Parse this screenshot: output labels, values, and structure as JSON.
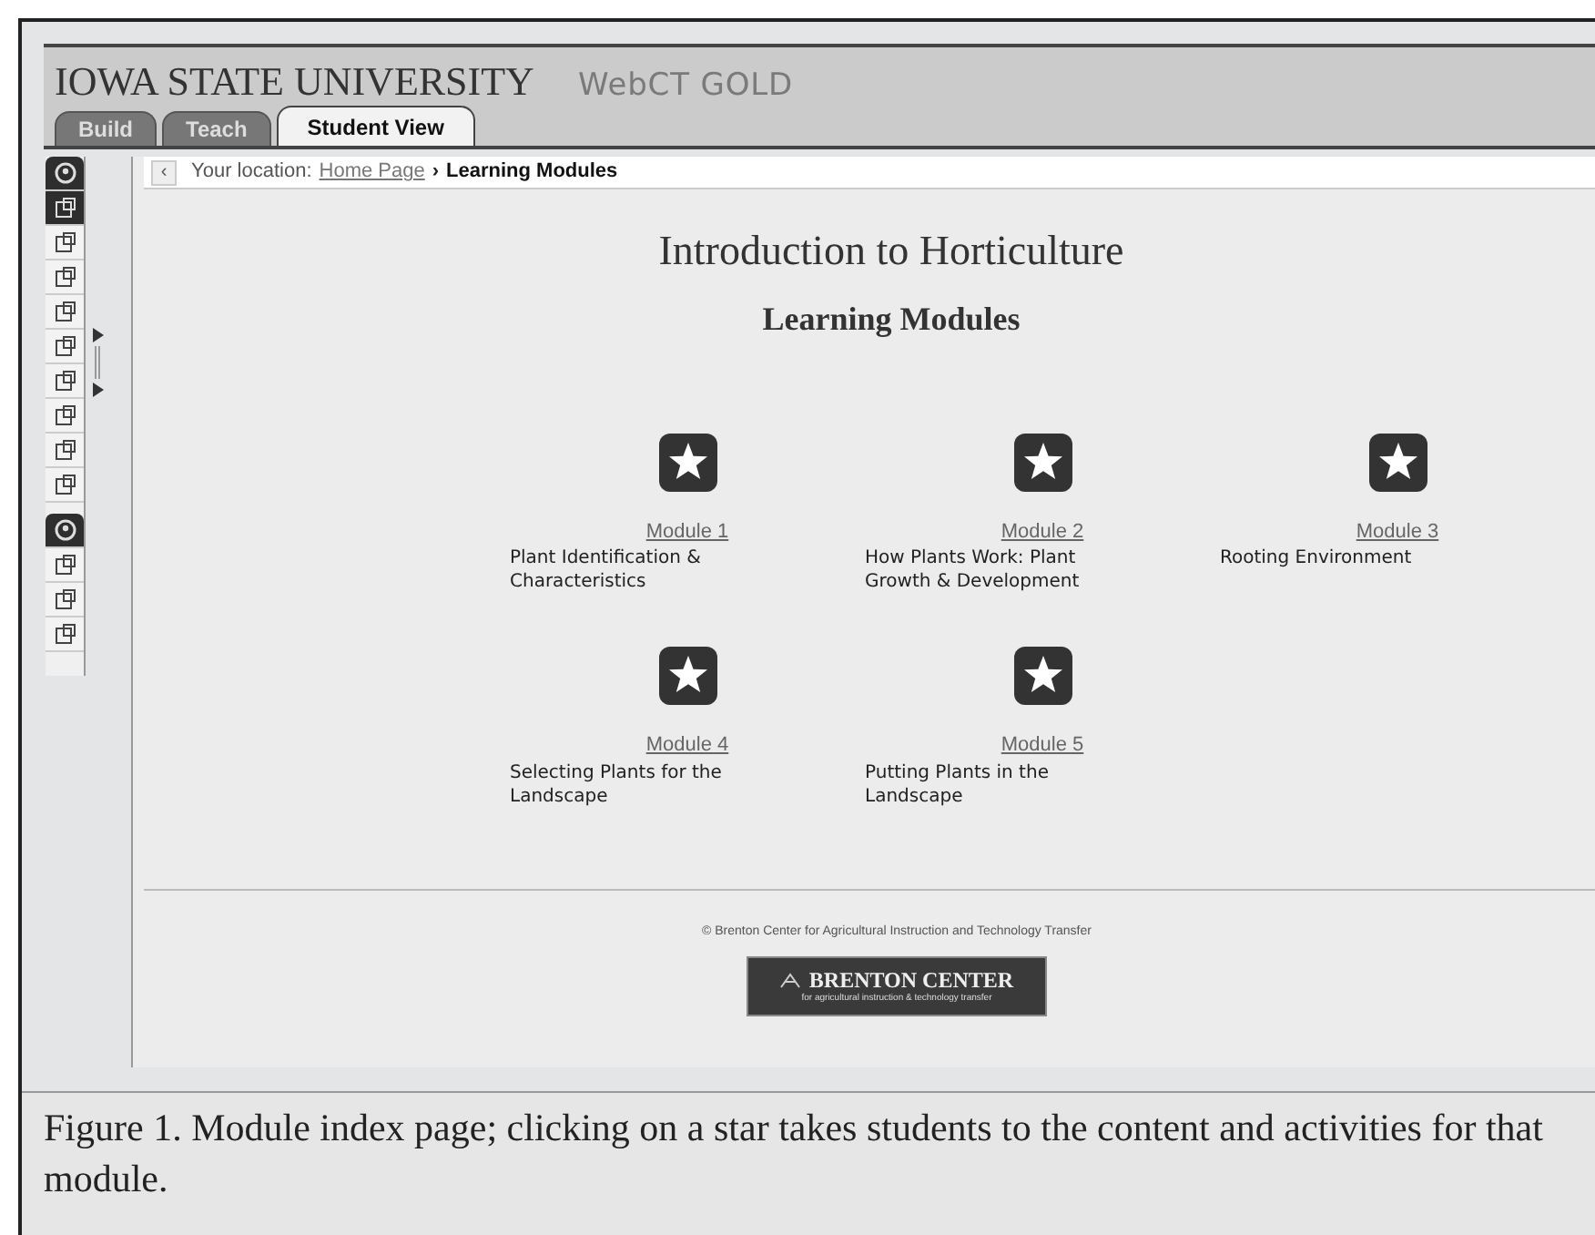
{
  "header": {
    "university": "IOWA STATE UNIVERSITY",
    "product": "WebCT GOLD"
  },
  "tabs": [
    {
      "label": "Build",
      "selected": false
    },
    {
      "label": "Teach",
      "selected": false
    },
    {
      "label": "Student View",
      "selected": true
    }
  ],
  "toolbar": [
    {
      "kind": "header"
    },
    {
      "kind": "tool",
      "selected": true
    },
    {
      "kind": "tool",
      "selected": false
    },
    {
      "kind": "tool",
      "selected": false
    },
    {
      "kind": "tool",
      "selected": false
    },
    {
      "kind": "tool",
      "selected": false
    },
    {
      "kind": "tool",
      "selected": false
    },
    {
      "kind": "tool",
      "selected": false
    },
    {
      "kind": "tool",
      "selected": false
    },
    {
      "kind": "tool",
      "selected": false
    },
    {
      "kind": "header"
    },
    {
      "kind": "tool",
      "selected": false
    },
    {
      "kind": "tool",
      "selected": false
    },
    {
      "kind": "tool",
      "selected": false
    }
  ],
  "breadcrumb": {
    "back": "‹",
    "prefix": "Your location:",
    "link": "Home Page",
    "separator": "›",
    "current": "Learning Modules"
  },
  "title": "Introduction to Horticulture",
  "subtitle": "Learning Modules",
  "modules": [
    {
      "link": "Module 1",
      "description": "Plant Identification & Characteristics"
    },
    {
      "link": "Module 2",
      "description": "How Plants Work: Plant Growth & Development"
    },
    {
      "link": "Module 3",
      "description": "Rooting Environment"
    },
    {
      "link": "Module 4",
      "description": "Selecting Plants for the Landscape"
    },
    {
      "link": "Module 5",
      "description": "Putting Plants in the Landscape"
    }
  ],
  "footer": {
    "copyright": "© Brenton Center for Agricultural Instruction and Technology Transfer",
    "logo_name": "BRENTON CENTER",
    "logo_tagline": "for agricultural instruction & technology transfer"
  },
  "caption": "Figure 1. Module index page; clicking on a star takes students to the content and activities for that module."
}
